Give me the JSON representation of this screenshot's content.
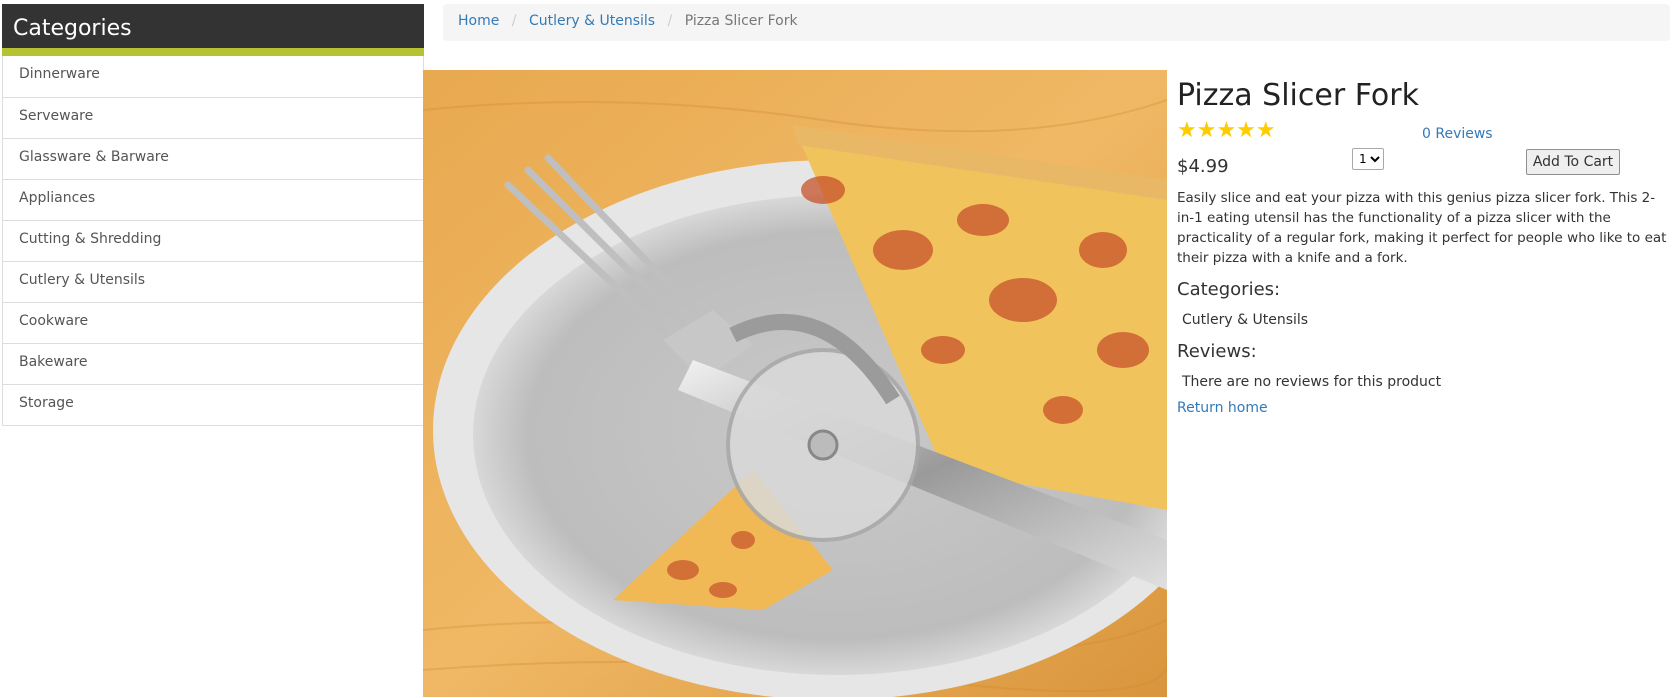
{
  "sidebar": {
    "title": "Categories",
    "items": [
      {
        "label": "Dinnerware"
      },
      {
        "label": "Serveware"
      },
      {
        "label": "Glassware & Barware"
      },
      {
        "label": "Appliances"
      },
      {
        "label": "Cutting & Shredding"
      },
      {
        "label": "Cutlery & Utensils"
      },
      {
        "label": "Cookware"
      },
      {
        "label": "Bakeware"
      },
      {
        "label": "Storage"
      }
    ]
  },
  "breadcrumb": {
    "home": "Home",
    "category": "Cutlery & Utensils",
    "current": "Pizza Slicer Fork"
  },
  "product": {
    "title": "Pizza Slicer Fork",
    "stars": "★★★★★",
    "rating": 5,
    "reviews_link": "0 Reviews",
    "price": "$4.99",
    "quantity": "1",
    "add_to_cart": "Add To Cart",
    "description": "Easily slice and eat your pizza with this genius pizza slicer fork. This 2-in-1 eating utensil has the functionality of a pizza slicer with the practicality of a regular fork, making it perfect for people who like to eat their pizza with a knife and a fork.",
    "categories_label": "Categories:",
    "categories_value": "Cutlery & Utensils",
    "reviews_label": "Reviews:",
    "reviews_value": "There are no reviews for this product",
    "return_link": "Return home"
  },
  "colors": {
    "header_bg": "#333333",
    "header_accent": "#b6c232",
    "link": "#337ab7",
    "star": "#ffcc00"
  }
}
